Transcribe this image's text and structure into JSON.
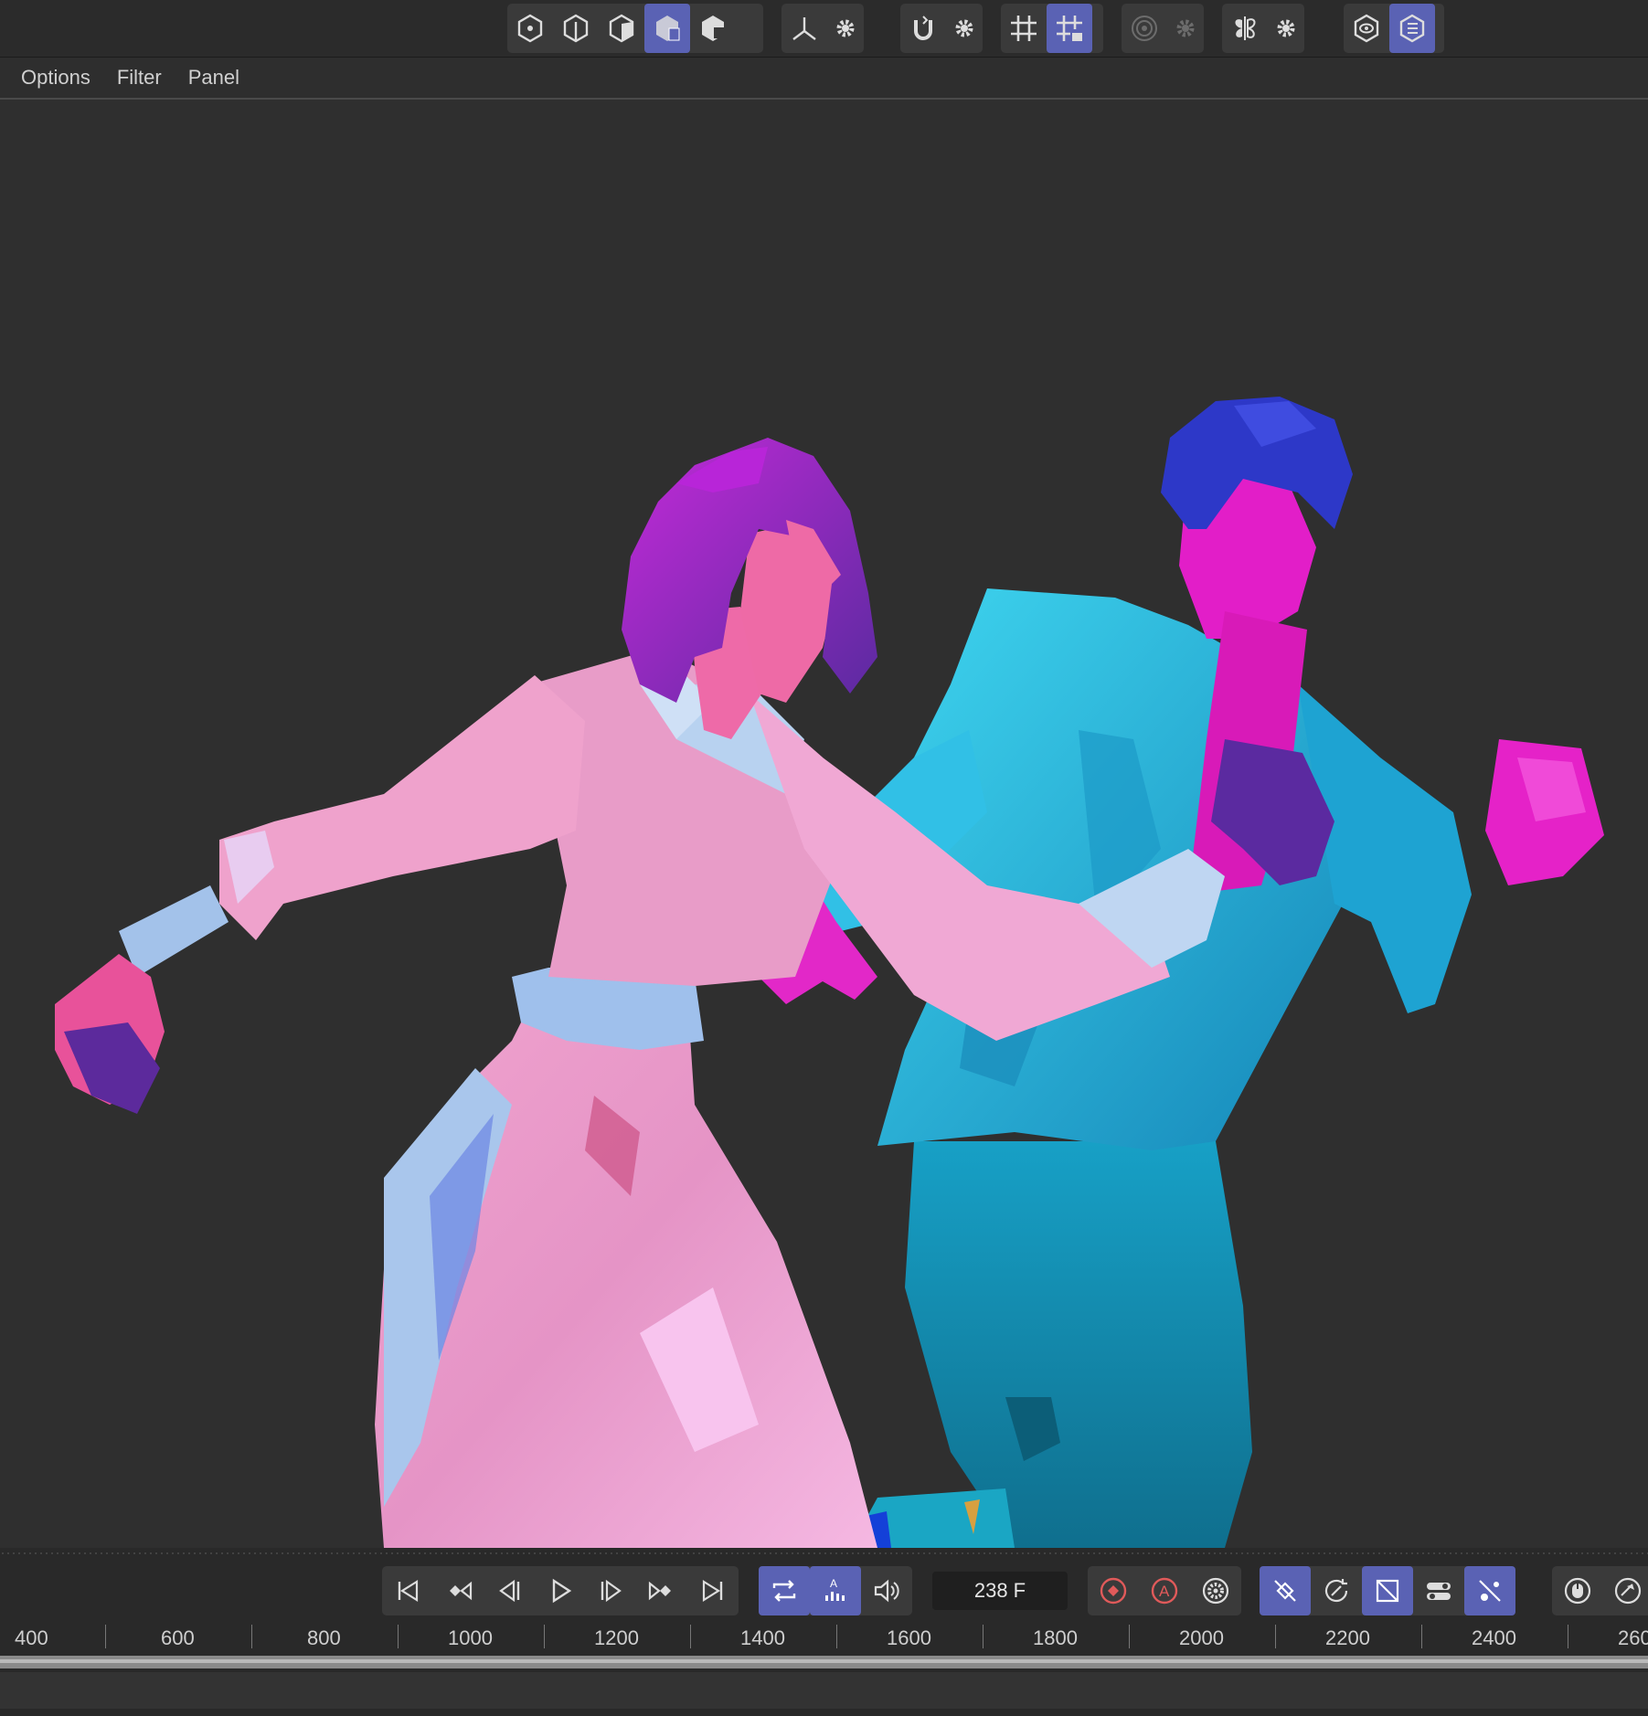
{
  "toolbar": {
    "groups": [
      {
        "name": "selection-mode",
        "buttons": [
          "points-mode-icon",
          "edges-mode-icon",
          "polygons-mode-icon",
          "model-mode-icon",
          "texture-mode-icon"
        ],
        "active": [
          3
        ]
      },
      {
        "name": "axis",
        "buttons": [
          "axis-icon",
          "settings-gear-icon"
        ]
      },
      {
        "name": "snap",
        "buttons": [
          "magnet-snap-icon",
          "settings-gear-icon"
        ]
      },
      {
        "name": "grid",
        "buttons": [
          "workplane-grid-icon",
          "locked-workplane-icon"
        ],
        "active": [
          1
        ]
      },
      {
        "name": "solo",
        "buttons": [
          "solo-target-icon",
          "settings-gear-icon"
        ],
        "disabled": true
      },
      {
        "name": "symmetry",
        "buttons": [
          "symmetry-butterfly-icon",
          "settings-gear-icon"
        ]
      },
      {
        "name": "view",
        "buttons": [
          "viewport-eye-icon",
          "display-filter-icon"
        ],
        "active": [
          1
        ]
      }
    ]
  },
  "menu": {
    "items": [
      "Options",
      "Filter",
      "Panel"
    ]
  },
  "viewport": {
    "scene": "two low-poly dancing characters"
  },
  "transport": {
    "frame_value": "238 F",
    "ruler_ticks": [
      "400",
      "600",
      "800",
      "1000",
      "1200",
      "1400",
      "1600",
      "1800",
      "2000",
      "2200",
      "2400",
      "260"
    ],
    "colors": {
      "accent": "#5a62b4",
      "record": "#e05a5a"
    }
  }
}
